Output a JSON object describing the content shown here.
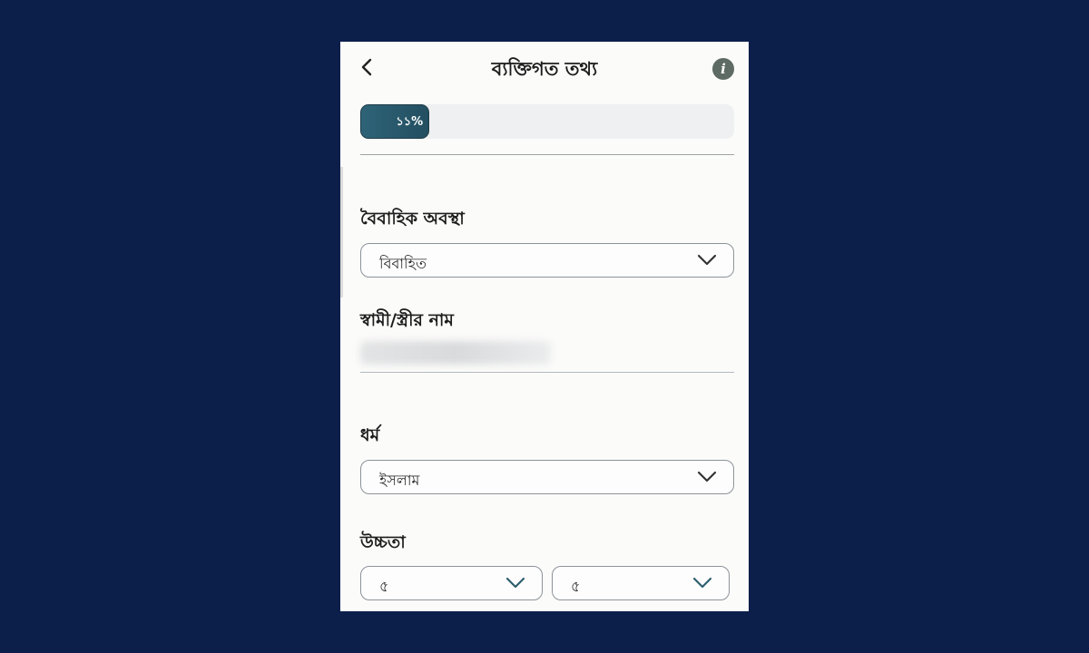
{
  "header": {
    "title": "ব্যক্তিগত তথ্য",
    "back_icon": "chevron-left-icon",
    "info_icon": "info-icon",
    "info_glyph": "i"
  },
  "progress": {
    "label": "১১%",
    "value_percent": 11
  },
  "form": {
    "marital_status": {
      "label": "বৈবাহিক অবস্থা",
      "value": "বিবাহিত"
    },
    "spouse_name": {
      "label": "স্বামী/স্ত্রীর নাম",
      "value": ""
    },
    "religion": {
      "label": "ধর্ম",
      "value": "ইসলাম"
    },
    "height": {
      "label": "উচ্চতা",
      "feet": "৫",
      "inches": "৫"
    }
  },
  "colors": {
    "background": "#0b1f4a",
    "panel": "#fbfbfa",
    "progress_fill": "#2e6377",
    "chevron": "#2f5f6e"
  }
}
